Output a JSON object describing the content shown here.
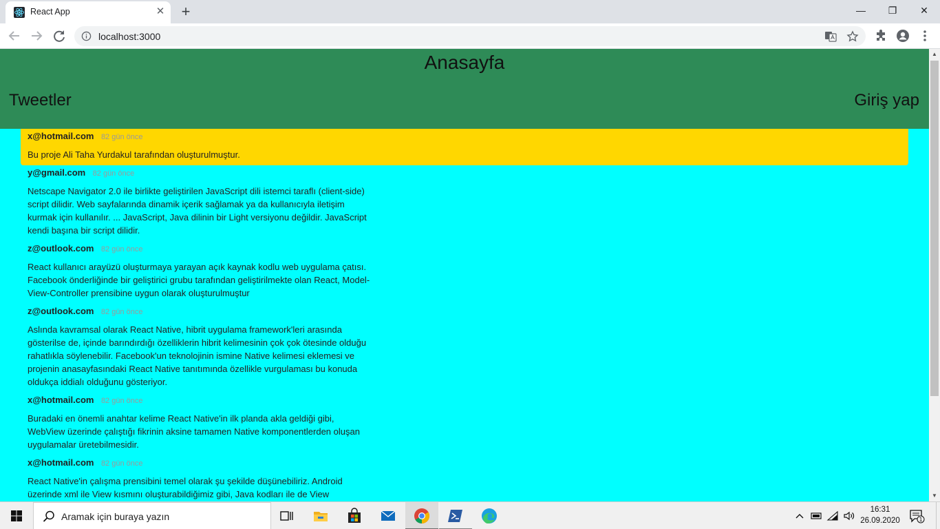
{
  "browser": {
    "tab_title": "React App",
    "tab_close": "✕",
    "new_tab": "+",
    "url": "localhost:3000",
    "window_controls": {
      "minimize": "—",
      "restore": "❐",
      "close": "✕"
    }
  },
  "app": {
    "title": "Anasayfa",
    "nav_left": "Tweetler",
    "nav_right": "Giriş yap",
    "colors": {
      "header_bg": "#2e8b57",
      "page_bg": "#00ffff",
      "highlight_bg": "#ffd700"
    }
  },
  "tweets": [
    {
      "email": "x@hotmail.com",
      "time": "82 gün önce",
      "text": "Bu proje Ali Taha Yurdakul tarafından oluşturulmuştur."
    },
    {
      "email": "y@gmail.com",
      "time": "82 gün önce",
      "text": "Netscape Navigator 2.0 ile birlikte geliştirilen JavaScript dili istemci taraflı (client-side) script dilidir. Web sayfalarında dinamik içerik sağlamak ya da kullanıcıyla iletişim kurmak için kullanılır. ... JavaScript, Java dilinin bir Light versiyonu değildir. JavaScript kendi başına bir script dilidir."
    },
    {
      "email": "z@outlook.com",
      "time": "82 gün önce",
      "text": "React kullanıcı arayüzü oluşturmaya yarayan açık kaynak kodlu web uygulama çatısı. Facebook önderliğinde bir geliştirici grubu tarafından geliştirilmekte olan React, Model-View-Controller prensibine uygun olarak oluşturulmuştur"
    },
    {
      "email": "z@outlook.com",
      "time": "82 gün önce",
      "text": "Aslında kavramsal olarak React Native, hibrit uygulama framework'leri arasında gösterilse de, içinde barındırdığı özelliklerin hibrit kelimesinin çok çok ötesinde olduğu rahatlıkla söylenebilir. Facebook'un teknolojinin ismine Native kelimesi eklemesi ve projenin anasayfasındaki React Native tanıtımında özellikle vurgulaması bu konuda oldukça iddialı olduğunu gösteriyor."
    },
    {
      "email": "x@hotmail.com",
      "time": "82 gün önce",
      "text": "Buradaki en önemli anahtar kelime React Native'in ilk planda akla geldiği gibi, WebView üzerinde çalıştığı fikrinin aksine tamamen Native komponentlerden oluşan uygulamalar üretebilmesidir."
    },
    {
      "email": "x@hotmail.com",
      "time": "82 gün önce",
      "text": "React Native'in çalışma prensibini temel olarak şu şekilde düşünebiliriz. Android üzerinde xml ile View kısmını oluşturabildiğimiz gibi, Java kodları ile de View oluşturabiliriz. Main Component olarak tanımladığımız JavaScript kodları, bridge üzerinden Native tarafa aktarılır."
    }
  ],
  "taskbar": {
    "search_placeholder": "Aramak için buraya yazın",
    "time": "16:31",
    "date": "26.09.2020",
    "notification_count": "1"
  }
}
